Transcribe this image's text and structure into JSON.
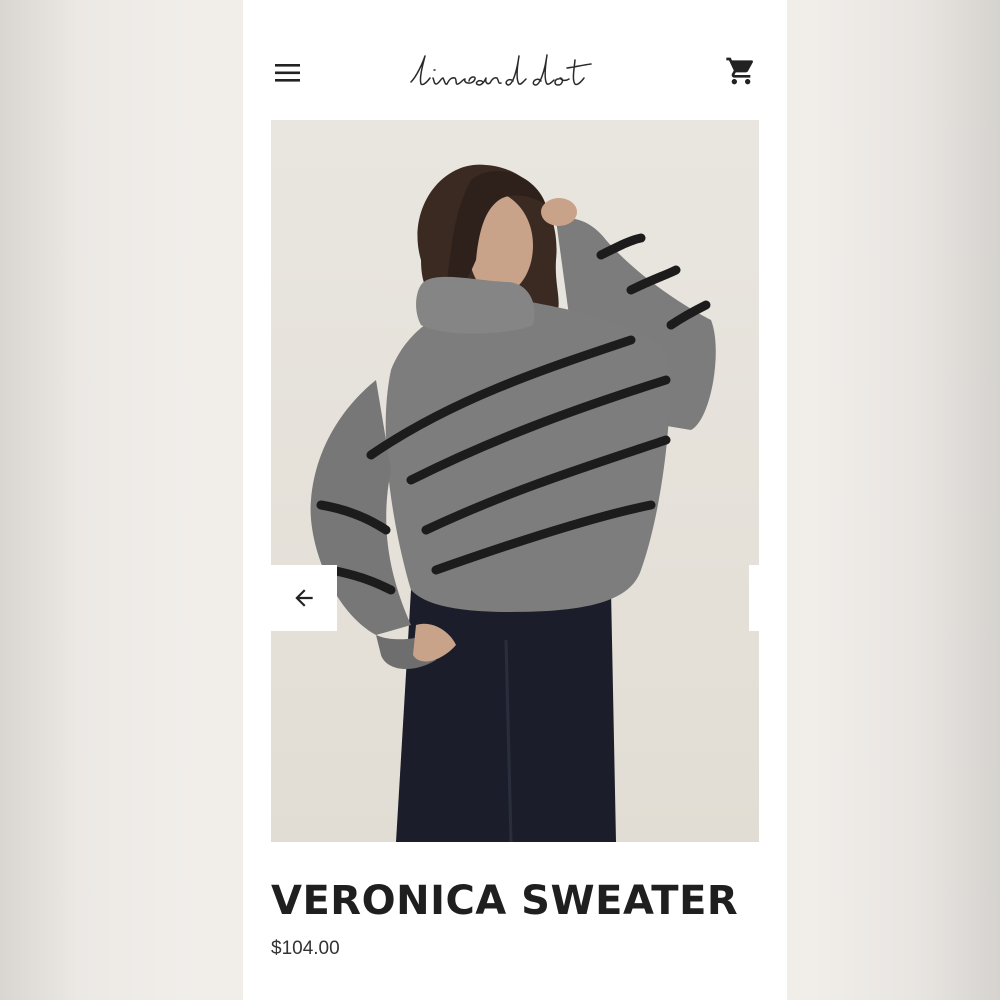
{
  "header": {
    "menu_icon": "hamburger-menu-icon",
    "logo_text": "lineanddot",
    "cart_icon": "shopping-cart-icon"
  },
  "carousel": {
    "image_alt": "Model wearing grey turtleneck sweater with black diagonal stripes",
    "prev_icon": "arrow-left-icon",
    "next_icon": "arrow-right-icon"
  },
  "product": {
    "name": "VERONICA SWEATER",
    "price": "$104.00"
  },
  "colors": {
    "background": "#ffffff",
    "text": "#1f1f1f",
    "photo_backdrop": "#e7e3dc",
    "sweater": "#7c7c7c",
    "stripe": "#1c1c1c",
    "pants": "#1b1e2a"
  }
}
